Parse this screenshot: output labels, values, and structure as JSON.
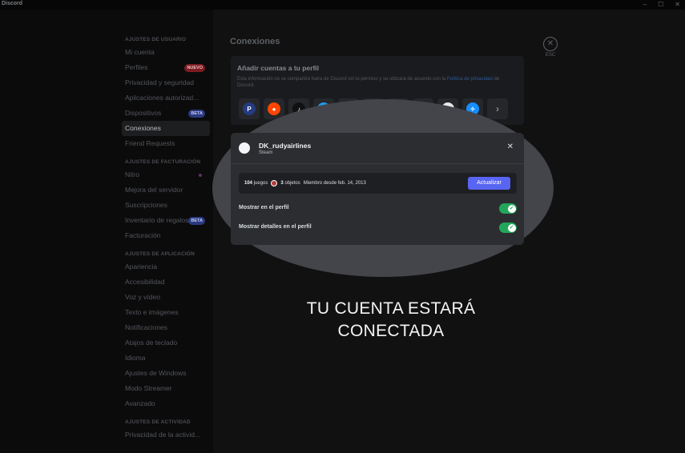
{
  "window": {
    "app_name": "Discord",
    "controls": [
      "–",
      "☐",
      "✕"
    ]
  },
  "sidebar": {
    "sections": [
      {
        "heading": "AJUSTES DE USUARIO",
        "items": [
          {
            "label": "Mi cuenta"
          },
          {
            "label": "Perfiles",
            "badge": "NUEVO"
          },
          {
            "label": "Privacidad y seguridad"
          },
          {
            "label": "Aplicaciones autorizad..."
          },
          {
            "label": "Dispositivos",
            "badge": "BETA"
          },
          {
            "label": "Conexiones",
            "active": true
          },
          {
            "label": "Friend Requests"
          }
        ]
      },
      {
        "heading": "AJUSTES DE FACTURACIÓN",
        "items": [
          {
            "label": "Nitro"
          },
          {
            "label": "Mejora del servidor"
          },
          {
            "label": "Suscripciones"
          },
          {
            "label": "Inventario de regalos",
            "badge": "BETA"
          },
          {
            "label": "Facturación"
          }
        ]
      },
      {
        "heading": "AJUSTES DE APLICACIÓN",
        "items": [
          {
            "label": "Apariencia"
          },
          {
            "label": "Accesibilidad"
          },
          {
            "label": "Voz y vídeo"
          },
          {
            "label": "Texto e imágenes"
          },
          {
            "label": "Notificaciones"
          },
          {
            "label": "Atajos de teclado"
          },
          {
            "label": "Idioma"
          },
          {
            "label": "Ajustes de Windows"
          },
          {
            "label": "Modo Streamer"
          },
          {
            "label": "Avanzado"
          }
        ]
      },
      {
        "heading": "AJUSTES DE ACTIVIDAD",
        "items": [
          {
            "label": "Privacidad de la activid..."
          }
        ]
      }
    ]
  },
  "main": {
    "title": "Conexiones",
    "close_label": "ESC",
    "add_card": {
      "heading": "Añadir cuentas a tu perfil",
      "description": "Esta información no se compartirá fuera de Discord sin tu permiso y se utilizará de acuerdo con la",
      "link": "Política de privacidad",
      "description_end": "de Discord."
    },
    "services": [
      {
        "icon": "paypal-icon",
        "glyph": "P",
        "color": "#253b80"
      },
      {
        "icon": "reddit-icon",
        "glyph": "●",
        "color": "#ff4500"
      },
      {
        "icon": "tiktok-icon",
        "glyph": "♪",
        "color": "#111111"
      },
      {
        "icon": "twitter-icon",
        "glyph": "✦",
        "color": "#1d9bf0"
      },
      {
        "icon": "ebay-icon",
        "glyph": "e",
        "color": "#e53238"
      },
      {
        "icon": "crunchyroll-icon",
        "glyph": "C",
        "color": "#f47521"
      },
      {
        "icon": "playstation-icon",
        "glyph": "P",
        "color": "#3a3c41"
      },
      {
        "icon": "spotify-icon",
        "glyph": "≋",
        "color": "#1db954"
      },
      {
        "icon": "xbox-icon",
        "glyph": "✕",
        "color": "#e9e9e9"
      },
      {
        "icon": "battlenet-icon",
        "glyph": "✧",
        "color": "#148eff"
      },
      {
        "icon": "chevron-right-icon",
        "glyph": "›",
        "color": "#26272b"
      }
    ],
    "account": {
      "name": "DK_rudyairlines",
      "platform": "Steam",
      "games_count": "104",
      "games_label": "juegos",
      "items_count": "3",
      "items_label": "objetos",
      "member_since": "Miembro desde feb. 14, 2013",
      "update_label": "Actualizar",
      "options": [
        {
          "label": "Mostrar en el perfil",
          "enabled": true
        },
        {
          "label": "Mostrar detalles en el perfil",
          "enabled": true
        }
      ]
    }
  },
  "caption": {
    "line1": "TU CUENTA ESTARÁ",
    "line2": "CONECTADA"
  }
}
